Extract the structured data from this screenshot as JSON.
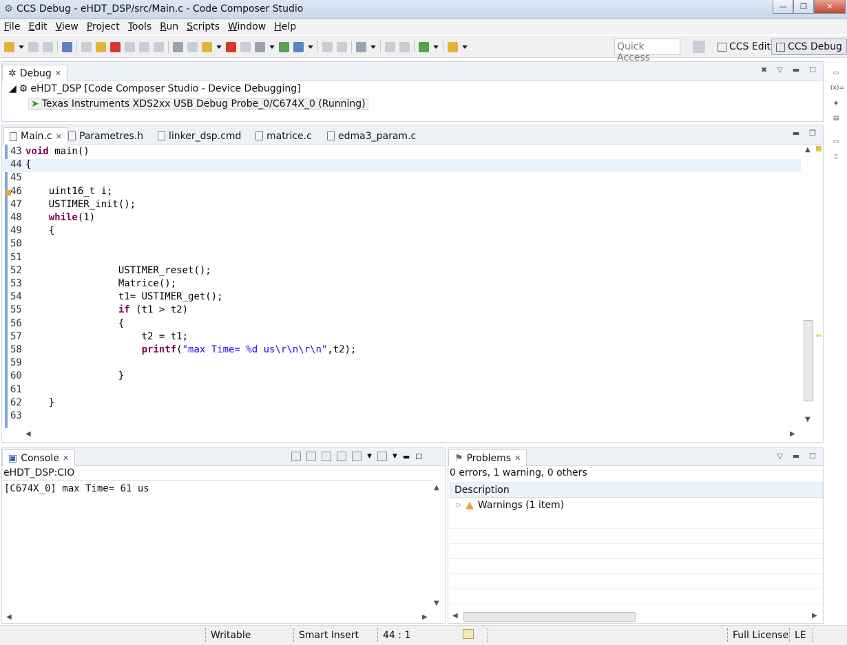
{
  "window": {
    "title": "CCS Debug - eHDT_DSP/src/Main.c - Code Composer Studio",
    "minimize": "—",
    "maximize": "❐",
    "close": "✕"
  },
  "menu": [
    "File",
    "Edit",
    "View",
    "Project",
    "Tools",
    "Run",
    "Scripts",
    "Window",
    "Help"
  ],
  "toolbar": {
    "quick_access_placeholder": "Quick Access",
    "perspective_edit": "CCS Edit",
    "perspective_debug": "CCS Debug"
  },
  "debug_view": {
    "tab_label": "Debug",
    "session": "eHDT_DSP [Code Composer Studio - Device Debugging]",
    "target": "Texas Instruments XDS2xx USB Debug Probe_0/C674X_0 (Running)"
  },
  "editor": {
    "tabs": [
      "Main.c",
      "Parametres.h",
      "linker_dsp.cmd",
      "matrice.c",
      "edma3_param.c"
    ],
    "lines": [
      {
        "n": "43",
        "t": "void main()"
      },
      {
        "n": "44",
        "t": "{"
      },
      {
        "n": "45",
        "t": ""
      },
      {
        "n": "46",
        "t": "    uint16_t i;"
      },
      {
        "n": "47",
        "t": "    USTIMER_init();"
      },
      {
        "n": "48",
        "t": "    while(1)"
      },
      {
        "n": "49",
        "t": "    {"
      },
      {
        "n": "50",
        "t": ""
      },
      {
        "n": "51",
        "t": ""
      },
      {
        "n": "52",
        "t": "                USTIMER_reset();"
      },
      {
        "n": "53",
        "t": "                Matrice();"
      },
      {
        "n": "54",
        "t": "                t1= USTIMER_get();"
      },
      {
        "n": "55",
        "t": "                if (t1 > t2)"
      },
      {
        "n": "56",
        "t": "                {"
      },
      {
        "n": "57",
        "t": "                    t2 = t1;"
      },
      {
        "n": "58",
        "t": "                    printf(\"max Time= %d us\\r\\n\\r\\n\",t2);"
      },
      {
        "n": "59",
        "t": ""
      },
      {
        "n": "60",
        "t": "                }"
      },
      {
        "n": "61",
        "t": ""
      },
      {
        "n": "62",
        "t": "    }"
      },
      {
        "n": "63",
        "t": ""
      }
    ]
  },
  "console": {
    "tab_label": "Console",
    "name": "eHDT_DSP:CIO",
    "output": "[C674X_0] max Time= 61 us"
  },
  "problems": {
    "tab_label": "Problems",
    "summary": "0 errors, 1 warning, 0 others",
    "column": "Description",
    "item": "Warnings (1 item)"
  },
  "status": {
    "writable": "Writable",
    "insert_mode": "Smart Insert",
    "position": "44 : 1",
    "license": "Full License",
    "endian": "LE"
  }
}
